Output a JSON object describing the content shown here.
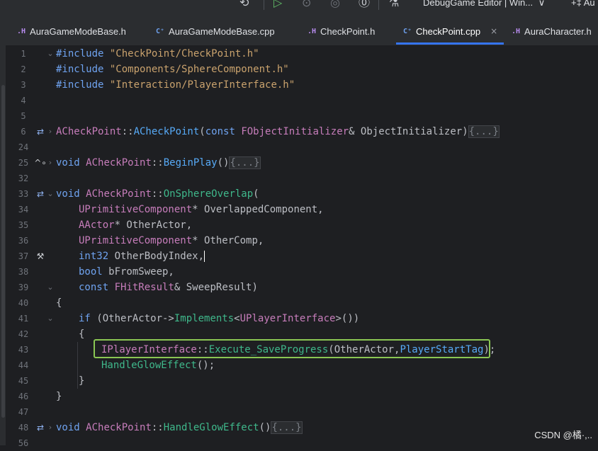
{
  "toolbar": {
    "config_label": "DebugGame Editor | Win...",
    "config_chevron": "∨",
    "run_target_label": "Au",
    "icons": [
      "sync-icon",
      "debug-run-icon",
      "step-icon",
      "stop-icon",
      "unreal-icon",
      "profile-icon"
    ]
  },
  "tabs": [
    {
      "type": ".H",
      "label": "AuraGameModeBase.h",
      "active": false
    },
    {
      "type": "C⁺",
      "label": "AuraGameModeBase.cpp",
      "active": false
    },
    {
      "type": ".H",
      "label": "CheckPoint.h",
      "active": false
    },
    {
      "type": "C⁺",
      "label": "CheckPoint.cpp",
      "active": true,
      "close": "×"
    },
    {
      "type": ".H",
      "label": "AuraCharacter.h",
      "active": false
    }
  ],
  "line_numbers": [
    "1",
    "2",
    "3",
    "4",
    "5",
    "6",
    "24",
    "25",
    "32",
    "33",
    "34",
    "35",
    "36",
    "37",
    "38",
    "39",
    "40",
    "41",
    "42",
    "43",
    "44",
    "45",
    "46",
    "47",
    "48",
    "56"
  ],
  "code": {
    "inc1_kw": "#include",
    "inc1_str": "\"CheckPoint/CheckPoint.h\"",
    "inc2_kw": "#include",
    "inc2_str": "\"Components/SphereComponent.h\"",
    "inc3_kw": "#include",
    "inc3_str": "\"Interaction/PlayerInterface.h\"",
    "ctor_cls": "ACheckPoint",
    "ctor_sep": "::",
    "ctor_fn": "ACheckPoint",
    "ctor_open": "(",
    "ctor_const": "const",
    "ctor_type": "FObjectInitializer",
    "ctor_rest": "& ObjectInitializer)",
    "ctor_fold": "{...}",
    "bp_void": "void",
    "bp_cls": "ACheckPoint",
    "bp_sep": "::",
    "bp_fn": "BeginPlay",
    "bp_paren": "()",
    "bp_fold": "{...}",
    "os_void": "void",
    "os_cls": "ACheckPoint",
    "os_sep": "::",
    "os_fn": "OnSphereOverlap",
    "os_open": "(",
    "p1_type": "UPrimitiveComponent",
    "p1_rest": "* OverlappedComponent,",
    "p2_type": "AActor",
    "p2_rest": "* OtherActor,",
    "p3_type": "UPrimitiveComponent",
    "p3_rest": "* OtherComp,",
    "p4_type": "int32",
    "p4_rest": " OtherBodyIndex,",
    "p5_type": "bool",
    "p5_rest": " bFromSweep,",
    "p6_const": "const",
    "p6_type": "FHitResult",
    "p6_rest": "& SweepResult)",
    "brace_open": "{",
    "if_kw": "if",
    "if_open": " (OtherActor->",
    "if_fn": "Implements",
    "if_lt": "<",
    "if_cls": "UPlayerInterface",
    "if_close": ">())",
    "inner_open": "{",
    "ex_cls": "IPlayerInterface",
    "ex_sep": "::",
    "ex_fn": "Execute_SaveProgress",
    "ex_args": "(OtherActor,",
    "ex_tag": "PlayerStartTag",
    "ex_end": ");",
    "hg_fn": "HandleGlowEffect",
    "hg_end": "();",
    "inner_close": "}",
    "brace_close": "}",
    "he_void": "void",
    "he_cls": "ACheckPoint",
    "he_sep": "::",
    "he_fn": "HandleGlowEffect",
    "he_paren": "()",
    "he_fold": "{...}"
  },
  "watermark": "CSDN @橘·,..",
  "colors": {
    "background": "#1e1f22",
    "keyword": "#6fa3f0",
    "string": "#c9a26d",
    "class": "#c77dbb",
    "function": "#57aaf7",
    "member": "#3fb88b",
    "highlight_box": "#8ac653",
    "active_tab_underline": "#3574f0"
  }
}
